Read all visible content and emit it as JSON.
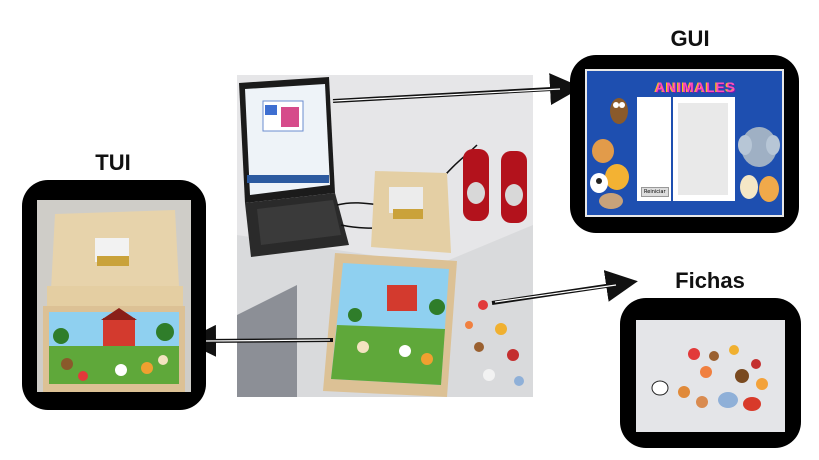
{
  "labels": {
    "gui": "GUI",
    "tui": "TUI",
    "fichas": "Fichas"
  },
  "gui_screen": {
    "title": "ANIMALES",
    "button": "Reiniciar"
  },
  "colors": {
    "frame": "#000000",
    "gui_background": "#1e4fb0",
    "board_wood": "#e8d2a8",
    "speaker_red": "#b3121c",
    "grass": "#5fa83a",
    "sky": "#8fd0f0"
  },
  "icons": {
    "arrow": "right-arrow-icon",
    "board": "puzzle-board-icon"
  }
}
